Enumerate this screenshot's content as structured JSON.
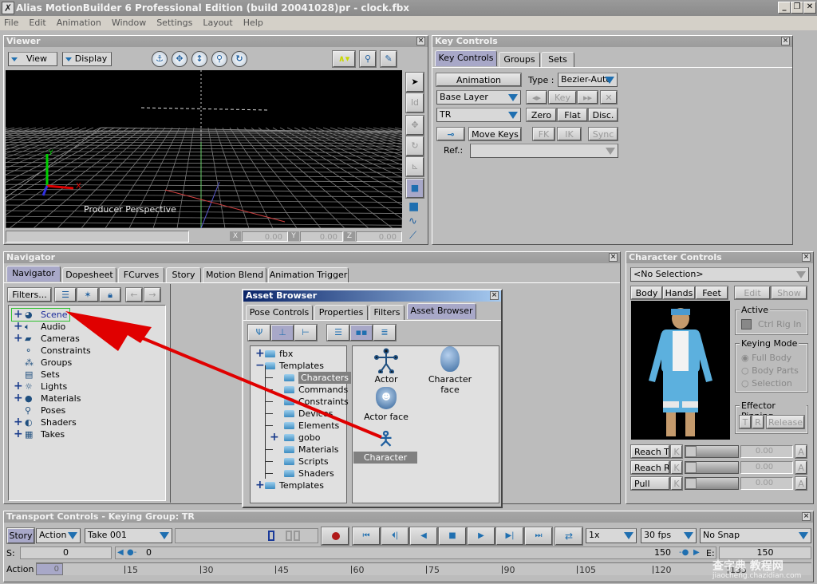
{
  "app": {
    "title": "Alias MotionBuilder 6 Professional Edition (build 20041028)pr - clock.fbx",
    "icon": "motionbuilder-logo-icon",
    "window_buttons": {
      "minimize": "_",
      "restore": "❐",
      "close": "✕"
    }
  },
  "menu": [
    "File",
    "Edit",
    "Animation",
    "Window",
    "Settings",
    "Layout",
    "Help"
  ],
  "viewer": {
    "title": "Viewer",
    "view_label": "View",
    "display_label": "Display",
    "camera_label": "Producer Perspective",
    "nav_icons": [
      "anchor-icon",
      "pan-icon",
      "dolly-icon",
      "zoom-icon",
      "orbit-icon"
    ],
    "right_icons": [
      "curve-mode-icon",
      "2d-zoom-icon",
      "pen-lock-icon"
    ],
    "side_tools": [
      "select-arrow-icon",
      "ld-icon",
      "translate-icon",
      "rotate-icon",
      "scale-icon",
      "select-model-icon",
      "cube-icon",
      "curve-icon",
      "bend-icon"
    ],
    "coords": {
      "x_label": "X",
      "x": "0.00",
      "y_label": "Y",
      "y": "0.00",
      "z_label": "Z",
      "z": "0.00"
    },
    "axis": {
      "x": "X",
      "y": "Y"
    }
  },
  "key_controls": {
    "title": "Key Controls",
    "tabs": [
      "Key Controls",
      "Groups",
      "Sets"
    ],
    "active_tab": 0,
    "animation_label": "Animation",
    "type_label": "Type :",
    "type_value": "Bezier-Auto",
    "layer_value": "Base Layer",
    "prev_key": "◂▸",
    "key_label": "Key",
    "next_key": "▸▸",
    "delete": "✕",
    "group_value": "TR",
    "zero": "Zero",
    "flat": "Flat",
    "disc": "Disc.",
    "move_keys": "Move Keys",
    "fk": "FK",
    "ik": "IK",
    "sync": "Sync",
    "ref_label": "Ref.:",
    "ref_value": ""
  },
  "navigator": {
    "title": "Navigator",
    "tabs": [
      "Navigator",
      "Dopesheet",
      "FCurves",
      "Story",
      "Motion Blend",
      "Animation Trigger"
    ],
    "active_tab": 0,
    "filters_label": "Filters...",
    "tree": [
      {
        "label": "Scene",
        "expandable": true,
        "icon": "scene-icon",
        "selected": true
      },
      {
        "label": "Audio",
        "expandable": true,
        "icon": "audio-icon"
      },
      {
        "label": "Cameras",
        "expandable": true,
        "icon": "camera-icon"
      },
      {
        "label": "Constraints",
        "expandable": false,
        "icon": "constraint-icon"
      },
      {
        "label": "Groups",
        "expandable": false,
        "icon": "groups-icon"
      },
      {
        "label": "Sets",
        "expandable": false,
        "icon": "sets-icon"
      },
      {
        "label": "Lights",
        "expandable": true,
        "icon": "light-icon"
      },
      {
        "label": "Materials",
        "expandable": true,
        "icon": "material-icon"
      },
      {
        "label": "Poses",
        "expandable": false,
        "icon": "pose-icon"
      },
      {
        "label": "Shaders",
        "expandable": true,
        "icon": "shader-icon"
      },
      {
        "label": "Takes",
        "expandable": true,
        "icon": "take-icon"
      }
    ]
  },
  "asset_browser": {
    "title": "Asset Browser",
    "tabs": [
      "Pose Controls",
      "Properties",
      "Filters",
      "Asset Browser"
    ],
    "active_tab": 3,
    "folders": [
      {
        "label": "fbx",
        "sign": "+",
        "level": 0
      },
      {
        "label": "Templates",
        "sign": "−",
        "level": 0
      },
      {
        "label": "Characters",
        "sign": "",
        "level": 1,
        "selected": true
      },
      {
        "label": "Commands",
        "sign": "",
        "level": 1
      },
      {
        "label": "Constraints",
        "sign": "",
        "level": 1
      },
      {
        "label": "Devices",
        "sign": "",
        "level": 1
      },
      {
        "label": "Elements",
        "sign": "",
        "level": 1
      },
      {
        "label": "gobo",
        "sign": "+",
        "level": 1
      },
      {
        "label": "Materials",
        "sign": "",
        "level": 1
      },
      {
        "label": "Scripts",
        "sign": "",
        "level": 1
      },
      {
        "label": "Shaders",
        "sign": "",
        "level": 1
      },
      {
        "label": "Templates",
        "sign": "+",
        "level": 0
      }
    ],
    "assets": [
      {
        "label": "Actor",
        "icon": "actor-icon"
      },
      {
        "label": "Character face",
        "icon": "character-face-icon"
      },
      {
        "label": "Actor face",
        "icon": "actor-face-icon"
      },
      {
        "label": "Character",
        "icon": "character-icon",
        "selected": true
      }
    ]
  },
  "character_controls": {
    "title": "Character Controls",
    "selection": "<No Selection>",
    "body_tabs": [
      "Body",
      "Hands",
      "Feet"
    ],
    "edit": "Edit",
    "show": "Show",
    "active": {
      "legend": "Active",
      "ctrl_rig": "Ctrl Rig In"
    },
    "keying_mode": {
      "legend": "Keying Mode",
      "options": [
        "Full Body",
        "Body Parts",
        "Selection"
      ],
      "selected": 0
    },
    "effector_pinning": {
      "legend": "Effector Pinning",
      "t": "T",
      "r": "R",
      "release": "Release"
    },
    "sliders": [
      {
        "label": "Reach T",
        "value": "0.00"
      },
      {
        "label": "Reach R",
        "value": "0.00"
      },
      {
        "label": "Pull",
        "value": "0.00"
      }
    ],
    "k_label": "K",
    "a_label": "A"
  },
  "transport": {
    "title": "Transport Controls  -  Keying Group: TR",
    "story": "Story",
    "action": "Action",
    "take": "Take 001",
    "speed": "1x",
    "fps": "30 fps",
    "snap": "No Snap",
    "s_label": "S:",
    "start": "0",
    "current": "0",
    "end_value": "150",
    "e_label": "E:",
    "end": "150",
    "timeline_label": "Action",
    "timeline_start": "0",
    "ticks": [
      "15",
      "30",
      "45",
      "60",
      "75",
      "90",
      "105",
      "120",
      "135"
    ]
  },
  "watermark": {
    "line1": "查字典 教程网",
    "line2": "jiaocheng.chazidian.com"
  }
}
